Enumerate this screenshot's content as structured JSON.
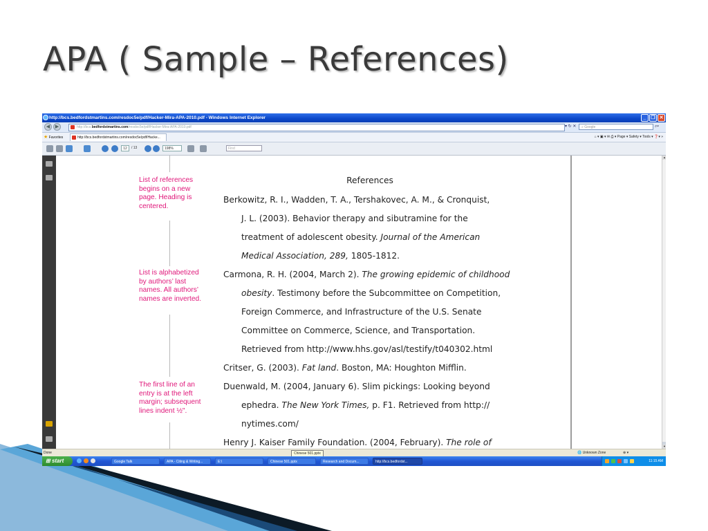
{
  "slide": {
    "title": "APA ( Sample – References)"
  },
  "browser": {
    "window_title": "http://bcs.bedfordstmartins.com/resdoc5e/pdf/Hacker-Mira-APA-2010.pdf - Windows Internet Explorer",
    "address_prefix": "http://bcs.",
    "address_host": "bedfordstmartins.com",
    "address_path": "/resdoc5e/pdf/Hacker-Mira-APA-2010.pdf",
    "search_placeholder": "Google",
    "favorites_label": "Favorites",
    "tab_label": "http://bcs.bedfordstmartins.com/resdoc5e/pdf/Hacke...",
    "command_bar": "Page ▾  Safety ▾  Tools ▾"
  },
  "reader": {
    "current_page": "12",
    "total_pages": "/ 13",
    "zoom": "198%",
    "find_placeholder": "Find"
  },
  "callouts": [
    {
      "lines": [
        "List of references",
        "begins on a new",
        "page. Heading is",
        "centered."
      ]
    },
    {
      "lines": [
        "List is alphabetized",
        "by authors’ last",
        "names. All authors’",
        "names are inverted."
      ]
    },
    {
      "lines": [
        "The first line of an",
        "entry is at the left",
        "margin; subsequent",
        "lines indent ½\"."
      ]
    }
  ],
  "references": {
    "heading": "References",
    "lines": [
      {
        "indent": false,
        "parts": [
          {
            "t": "Berkowitz, R. I., Wadden, T. A., Tershakovec, A. M., & Cronquist,"
          }
        ]
      },
      {
        "indent": true,
        "parts": [
          {
            "t": "J. L. (2003). Behavior therapy and sibutramine for the"
          }
        ]
      },
      {
        "indent": true,
        "parts": [
          {
            "t": "treatment of adolescent obesity. "
          },
          {
            "t": "Journal of the American",
            "i": true
          }
        ]
      },
      {
        "indent": true,
        "parts": [
          {
            "t": "Medical Association, 289,",
            "i": true
          },
          {
            "t": " 1805-1812."
          }
        ]
      },
      {
        "indent": false,
        "parts": [
          {
            "t": "Carmona, R. H. (2004, March 2). "
          },
          {
            "t": "The growing epidemic of childhood",
            "i": true
          }
        ]
      },
      {
        "indent": true,
        "parts": [
          {
            "t": "obesity",
            "i": true
          },
          {
            "t": ". Testimony before the Subcommittee on Competition,"
          }
        ]
      },
      {
        "indent": true,
        "parts": [
          {
            "t": "Foreign Commerce, and Infrastructure of the U.S. Senate"
          }
        ]
      },
      {
        "indent": true,
        "parts": [
          {
            "t": "Committee on Commerce, Science, and Transportation."
          }
        ]
      },
      {
        "indent": true,
        "parts": [
          {
            "t": "Retrieved from http://www.hhs.gov/asl/testify/t040302.html"
          }
        ]
      },
      {
        "indent": false,
        "parts": [
          {
            "t": "Critser, G. (2003). "
          },
          {
            "t": "Fat land",
            "i": true
          },
          {
            "t": ". Boston, MA: Houghton Mifflin."
          }
        ]
      },
      {
        "indent": false,
        "parts": [
          {
            "t": "Duenwald, M. (2004, January 6). Slim pickings: Looking beyond"
          }
        ]
      },
      {
        "indent": true,
        "parts": [
          {
            "t": "ephedra. "
          },
          {
            "t": "The New York Times,",
            "i": true
          },
          {
            "t": " p. F1. Retrieved from http://"
          }
        ]
      },
      {
        "indent": true,
        "parts": [
          {
            "t": "nytimes.com/"
          }
        ]
      },
      {
        "indent": false,
        "parts": [
          {
            "t": "Henry J. Kaiser Family Foundation. (2004, February). "
          },
          {
            "t": "The role of",
            "i": true
          }
        ]
      }
    ]
  },
  "status": {
    "left": "Done",
    "tooltip": "Chinese 501.pptx",
    "zone": "Unknown Zone",
    "zoom": "⊕ ▾"
  },
  "taskbar": {
    "start_label": "start",
    "tasks": [
      "Google Talk",
      "APA - Citing & Writing...",
      "E:\\",
      "Chinese 501.pptx",
      "Research and Docum...",
      "http://bcs.bedfordst..."
    ],
    "clock": "11:15 AM"
  },
  "colors": {
    "callout_text": "#e0177a",
    "ie_titlebar": "#0a46c9",
    "taskbar": "#2157d4",
    "deco_dark": "#0c1a26",
    "deco_blue": "#2e7fbf"
  }
}
